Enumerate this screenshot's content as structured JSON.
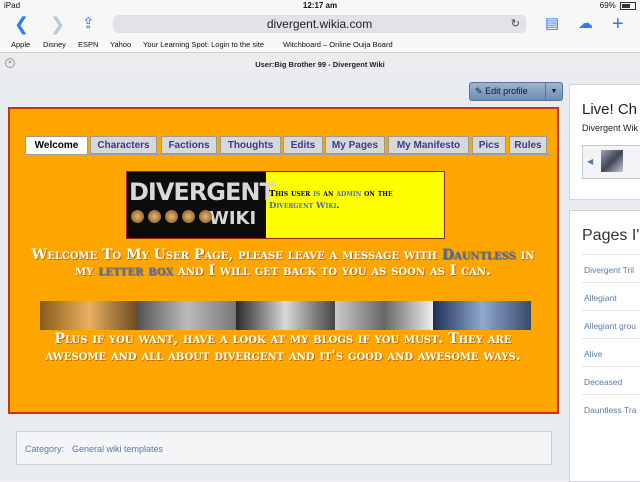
{
  "status": {
    "device": "iPad",
    "time": "12:17 am",
    "battery": "69%"
  },
  "browser": {
    "url": "divergent.wikia.com",
    "page_title": "User:Big Brother 99 - Divergent Wiki",
    "bookmarks": [
      "Apple",
      "Disney",
      "ESPN",
      "Yahoo",
      "Your Learning Spot: Login to the site",
      "Witchboard – Online Ouija Board"
    ]
  },
  "page": {
    "edit_button": "Edit profile",
    "tabs": [
      "Welcome",
      "Characters",
      "Factions",
      "Thoughts",
      "Edits",
      "My Pages",
      "My Manifesto",
      "Pics",
      "Rules"
    ],
    "banner": {
      "logo_line1": "DIVERGENT",
      "logo_line2": "WIKI",
      "t1": "This user ",
      "t2": "is",
      "t3": " an ",
      "t4": "admin",
      "t5": " on the ",
      "t6": "Divergent Wiki",
      "t7": "."
    },
    "welcome": {
      "p1": "Welcome To My User Page, please leave a message with ",
      "p2": "Dauntless",
      "p3": " in my ",
      "p4": "letter box",
      "p5": " and I will get back to you as soon as I can."
    },
    "plus": "Plus if you want, have a look at my blogs if you must. They are awesome and all about divergent and it's good and awesome ways.",
    "category": {
      "label": "Category:",
      "value": "General wiki templates"
    }
  },
  "rail": {
    "live_title": "Live! Ch",
    "live_sub": "Divergent Wik",
    "pages_title": "Pages I'",
    "pages": [
      "Divergent Tril",
      "Allegiant",
      "Allegiant grou",
      "Alive",
      "Deceased",
      "Dauntless Tra"
    ]
  },
  "colors": {
    "accent": "#ffa500",
    "border": "#c7370a",
    "link": "#5a7ba8",
    "banner": "#ffff00"
  }
}
